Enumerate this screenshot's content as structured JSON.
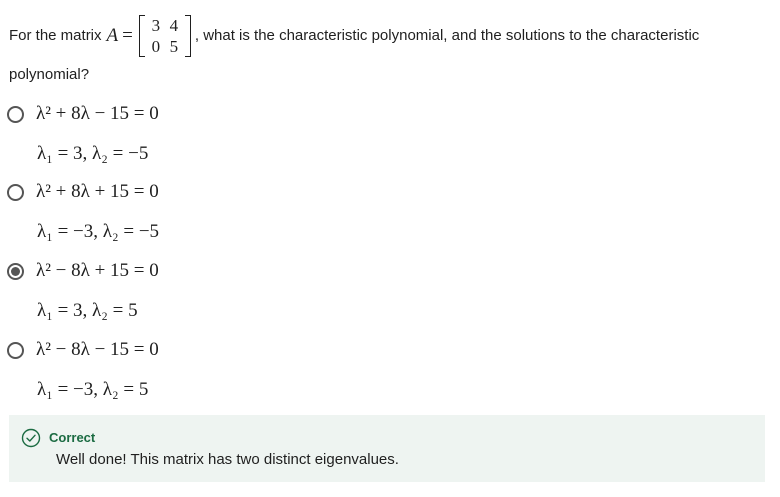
{
  "question": {
    "prefix": "For the matrix",
    "matrix_var": "A",
    "matrix_eq": "=",
    "matrix": [
      "3",
      "4",
      "0",
      "5"
    ],
    "suffix": ", what is the characteristic polynomial, and the solutions to the characteristic",
    "line2": "polynomial?"
  },
  "options": [
    {
      "equation": "λ² + 8λ − 15 = 0",
      "solution": "λ₁ = 3, λ₂ = −5",
      "selected": false
    },
    {
      "equation": "λ² + 8λ + 15 = 0",
      "solution": "λ₁ = −3, λ₂ = −5",
      "selected": false
    },
    {
      "equation": "λ² − 8λ + 15 = 0",
      "solution": "λ₁ = 3, λ₂ = 5",
      "selected": true
    },
    {
      "equation": "λ² − 8λ − 15 = 0",
      "solution": "λ₁ = −3, λ₂ = 5",
      "selected": false
    }
  ],
  "feedback": {
    "title": "Correct",
    "message": "Well done! This matrix has two distinct eigenvalues.",
    "icon": "check-circle-icon",
    "accent_color": "#1b6b42",
    "background_color": "#eef4f1"
  }
}
